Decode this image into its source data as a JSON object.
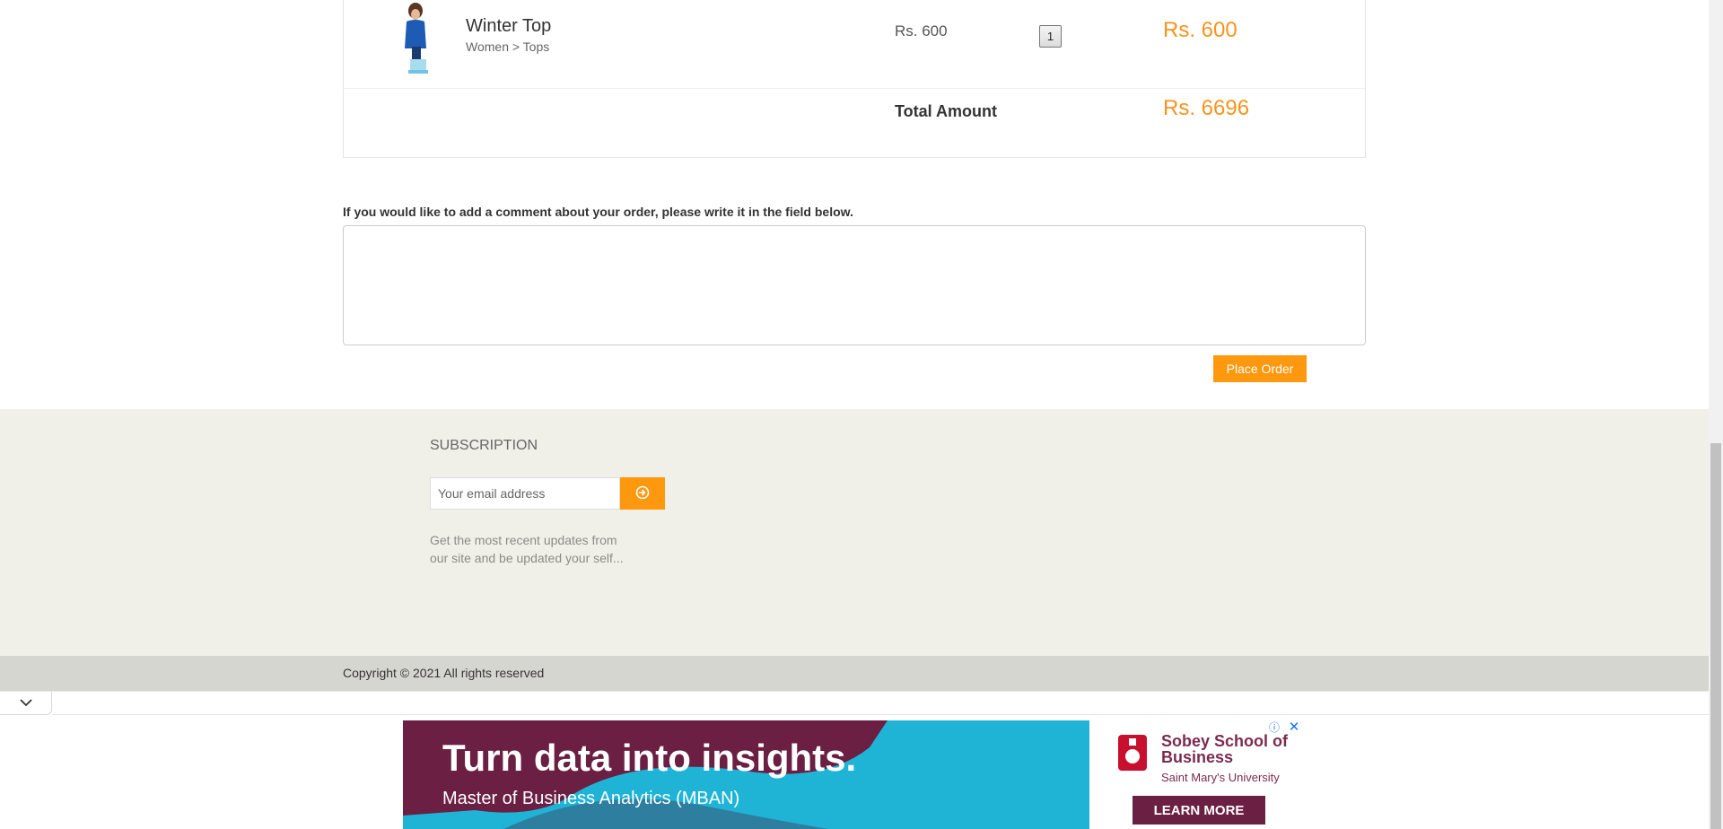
{
  "cart": {
    "item": {
      "name": "Winter Top",
      "category": "Women > Tops",
      "unit_price": "Rs. 600",
      "quantity": "1",
      "line_total": "Rs. 600"
    },
    "total_label": "Total Amount",
    "total_value": "Rs. 6696"
  },
  "comment": {
    "label": "If you would like to add a comment about your order, please write it in the field below.",
    "value": "",
    "place_order_label": "Place Order"
  },
  "footer": {
    "subscription_title": "SUBSCRIPTION",
    "email_placeholder": "Your email address",
    "subscription_text": "Get the most recent updates from our site and be updated your self...",
    "copyright": "Copyright © 2021 All rights reserved",
    "subscribe_icon": "arrow-circle-right-icon"
  },
  "ad": {
    "headline": "Turn data into insights.",
    "subline": "Master of Business Analytics (MBAN)",
    "school_name": "Sobey School of Business",
    "university": "Saint Mary's University",
    "cta_label": "LEARN MORE",
    "info_glyph": "ⓘ",
    "close_glyph": "✕"
  },
  "colors": {
    "accent": "#fe980f",
    "price": "#f7931e",
    "footer_bg": "#f0f0e9",
    "footer_bottom_bg": "#d6d6d0",
    "ad_blue": "#1fb4d6",
    "ad_maroon": "#6a1f43"
  }
}
